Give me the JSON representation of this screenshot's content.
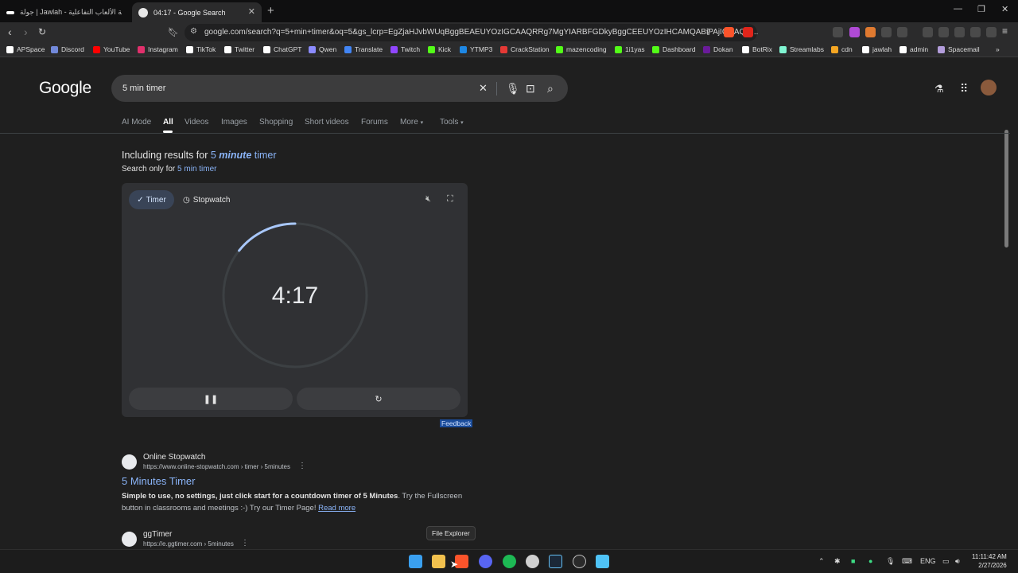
{
  "browser": {
    "tabs": [
      {
        "title": "جولة | Jawlah - منصة الألعاب التفاعلية"
      },
      {
        "title": "04:17 - Google Search"
      }
    ],
    "url": "google.com/search?q=5+min+timer&oq=5&gs_lcrp=EgZjaHJvbWUqBggBEAEUYOzIGCAAQRRg7MgYIARBFGDkyBggCEEUYOzIHCAMQABiPAjIGCAQQ...",
    "bookmarks": [
      {
        "label": "APSpace",
        "color": "#ffffff"
      },
      {
        "label": "Discord",
        "color": "#7289da"
      },
      {
        "label": "YouTube",
        "color": "#ff0000"
      },
      {
        "label": "Instagram",
        "color": "#e1306c"
      },
      {
        "label": "TikTok",
        "color": "#ffffff"
      },
      {
        "label": "Twitter",
        "color": "#ffffff"
      },
      {
        "label": "ChatGPT",
        "color": "#ffffff"
      },
      {
        "label": "Qwen",
        "color": "#8b8bff"
      },
      {
        "label": "Translate",
        "color": "#4285f4"
      },
      {
        "label": "Twitch",
        "color": "#9146ff"
      },
      {
        "label": "Kick",
        "color": "#53fc18"
      },
      {
        "label": "YTMP3",
        "color": "#1e88e5"
      },
      {
        "label": "CrackStation",
        "color": "#e53935"
      },
      {
        "label": "mazencoding",
        "color": "#53fc18"
      },
      {
        "label": "1i1yas",
        "color": "#53fc18"
      },
      {
        "label": "Dashboard",
        "color": "#53fc18"
      },
      {
        "label": "Dokan",
        "color": "#6a1b9a"
      },
      {
        "label": "BotRix",
        "color": "#ffffff"
      },
      {
        "label": "Streamlabs",
        "color": "#80f5d2"
      },
      {
        "label": "cdn",
        "color": "#f5a623"
      },
      {
        "label": "jawlah",
        "color": "#ffffff"
      },
      {
        "label": "admin",
        "color": "#ffffff"
      },
      {
        "label": "Spacemail",
        "color": "#b39ddb"
      }
    ]
  },
  "google": {
    "logo": "Google",
    "query": "5 min timer",
    "filters": [
      "AI Mode",
      "All",
      "Videos",
      "Images",
      "Shopping",
      "Short videos",
      "Forums",
      "More",
      "Tools"
    ],
    "including": {
      "prefix": "Including results for ",
      "num": "5 ",
      "word": "minute",
      "suffix": " timer"
    },
    "search_only": {
      "prefix": "Search only for ",
      "link": "5 min timer"
    },
    "timer": {
      "timer_label": "Timer",
      "stopwatch_label": "Stopwatch",
      "time": "4:17",
      "remaining_fraction": 0.857,
      "feedback": "Feedback"
    },
    "results": [
      {
        "site": "Online Stopwatch",
        "url": "https://www.online-stopwatch.com › timer › 5minutes",
        "title": "5 Minutes Timer",
        "snippet_bold": "Simple to use, no settings, just click start for a countdown timer of 5 Minutes",
        "snippet_rest": ". Try the Fullscreen button in classrooms and meetings :-) Try our Timer Page! ",
        "read_more": "Read more"
      },
      {
        "site": "ggTimer",
        "url": "https://e.ggtimer.com › 5minutes"
      }
    ],
    "tooltip": "File Explorer"
  },
  "taskbar": {
    "language": "ENG",
    "time": "11:11:42 AM",
    "date": "2/27/2026"
  }
}
